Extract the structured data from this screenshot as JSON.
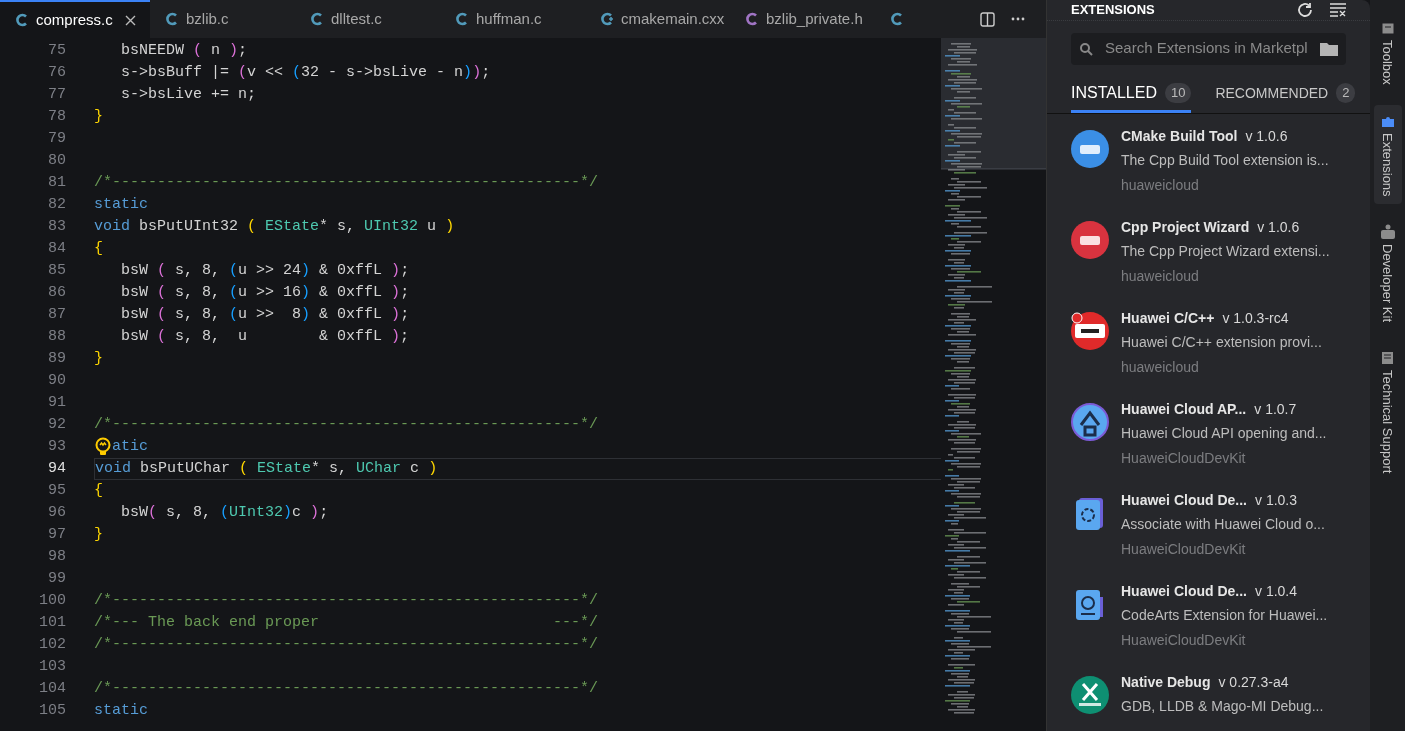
{
  "tabs": [
    {
      "label": "compress.c",
      "kind": "c",
      "selected": true
    },
    {
      "label": "bzlib.c",
      "kind": "c",
      "selected": false
    },
    {
      "label": "dlltest.c",
      "kind": "c",
      "selected": false
    },
    {
      "label": "huffman.c",
      "kind": "c",
      "selected": false
    },
    {
      "label": "cmakemain.cxx",
      "kind": "cpp",
      "selected": false
    },
    {
      "label": "bzlib_private.h",
      "kind": "h",
      "selected": false
    },
    {
      "kind": "c",
      "selected": false
    }
  ],
  "editor": {
    "lines": [
      {
        "number": "75",
        "tokens": [
          {
            "t": "   bsNEEDW ",
            "kind": "plain"
          },
          {
            "t": "(",
            "kind": "b2"
          },
          {
            "t": " n ",
            "kind": "plain"
          },
          {
            "t": ")",
            "kind": "b2"
          },
          {
            "t": ";",
            "kind": "plain"
          }
        ]
      },
      {
        "number": "76",
        "tokens": [
          {
            "t": "   s->bsBuff |= ",
            "kind": "plain"
          },
          {
            "t": "(",
            "kind": "b2"
          },
          {
            "t": "v << ",
            "kind": "plain"
          },
          {
            "t": "(",
            "kind": "b3"
          },
          {
            "t": "32 - s->bsLive - n",
            "kind": "plain"
          },
          {
            "t": ")",
            "kind": "b3"
          },
          {
            "t": ")",
            "kind": "b2"
          },
          {
            "t": ";",
            "kind": "plain"
          }
        ]
      },
      {
        "number": "77",
        "tokens": [
          {
            "t": "   s->bsLive += n;",
            "kind": "plain"
          }
        ]
      },
      {
        "number": "78",
        "tokens": [
          {
            "t": "}",
            "kind": "b1"
          }
        ]
      },
      {
        "number": "79"
      },
      {
        "number": "80"
      },
      {
        "number": "81",
        "tokens": [
          {
            "t": "/*----------------------------------------------------*/",
            "kind": "comment"
          }
        ]
      },
      {
        "number": "82",
        "tokens": [
          {
            "t": "static",
            "kind": "keyword"
          }
        ]
      },
      {
        "number": "83",
        "tokens": [
          {
            "t": "void",
            "kind": "keyword"
          },
          {
            "t": " bsPutUInt32 ",
            "kind": "plain"
          },
          {
            "t": "( ",
            "kind": "b1"
          },
          {
            "t": "EState",
            "kind": "type"
          },
          {
            "t": "* s, ",
            "kind": "plain"
          },
          {
            "t": "UInt32",
            "kind": "type"
          },
          {
            "t": " u ",
            "kind": "plain"
          },
          {
            "t": ")",
            "kind": "b1"
          }
        ]
      },
      {
        "number": "84",
        "tokens": [
          {
            "t": "{",
            "kind": "b1"
          }
        ]
      },
      {
        "number": "85",
        "tokens": [
          {
            "t": "   bsW ",
            "kind": "plain"
          },
          {
            "t": "(",
            "kind": "b2"
          },
          {
            "t": " s, 8, ",
            "kind": "plain"
          },
          {
            "t": "(",
            "kind": "b3"
          },
          {
            "t": "u >> 24",
            "kind": "plain"
          },
          {
            "t": ")",
            "kind": "b3"
          },
          {
            "t": " & 0xffL ",
            "kind": "plain"
          },
          {
            "t": ")",
            "kind": "b2"
          },
          {
            "t": ";",
            "kind": "plain"
          }
        ]
      },
      {
        "number": "86",
        "tokens": [
          {
            "t": "   bsW ",
            "kind": "plain"
          },
          {
            "t": "(",
            "kind": "b2"
          },
          {
            "t": " s, 8, ",
            "kind": "plain"
          },
          {
            "t": "(",
            "kind": "b3"
          },
          {
            "t": "u >> 16",
            "kind": "plain"
          },
          {
            "t": ")",
            "kind": "b3"
          },
          {
            "t": " & 0xffL ",
            "kind": "plain"
          },
          {
            "t": ")",
            "kind": "b2"
          },
          {
            "t": ";",
            "kind": "plain"
          }
        ]
      },
      {
        "number": "87",
        "tokens": [
          {
            "t": "   bsW ",
            "kind": "plain"
          },
          {
            "t": "(",
            "kind": "b2"
          },
          {
            "t": " s, 8, ",
            "kind": "plain"
          },
          {
            "t": "(",
            "kind": "b3"
          },
          {
            "t": "u >>  8",
            "kind": "plain"
          },
          {
            "t": ")",
            "kind": "b3"
          },
          {
            "t": " & 0xffL ",
            "kind": "plain"
          },
          {
            "t": ")",
            "kind": "b2"
          },
          {
            "t": ";",
            "kind": "plain"
          }
        ]
      },
      {
        "number": "88",
        "tokens": [
          {
            "t": "   bsW ",
            "kind": "plain"
          },
          {
            "t": "(",
            "kind": "b2"
          },
          {
            "t": " s, 8,  u        & 0xffL ",
            "kind": "plain"
          },
          {
            "t": ")",
            "kind": "b2"
          },
          {
            "t": ";",
            "kind": "plain"
          }
        ]
      },
      {
        "number": "89",
        "tokens": [
          {
            "t": "}",
            "kind": "b1"
          }
        ]
      },
      {
        "number": "90"
      },
      {
        "number": "91"
      },
      {
        "number": "92",
        "tokens": [
          {
            "t": "/*----------------------------------------------------*/",
            "kind": "comment"
          }
        ]
      },
      {
        "number": "93",
        "lightbulb": true,
        "tokens": [
          {
            "t": "atic",
            "kind": "keyword"
          }
        ]
      },
      {
        "number": "94",
        "current": true,
        "tokens": [
          {
            "t": "void",
            "kind": "keyword"
          },
          {
            "t": " bsPutUChar ",
            "kind": "plain"
          },
          {
            "t": "( ",
            "kind": "b1"
          },
          {
            "t": "EState",
            "kind": "type"
          },
          {
            "t": "* s, ",
            "kind": "plain"
          },
          {
            "t": "UChar",
            "kind": "type"
          },
          {
            "t": " c ",
            "kind": "plain"
          },
          {
            "t": ")",
            "kind": "b1"
          }
        ]
      },
      {
        "number": "95",
        "tokens": [
          {
            "t": "{",
            "kind": "b1"
          }
        ]
      },
      {
        "number": "96",
        "tokens": [
          {
            "t": "   bsW",
            "kind": "plain"
          },
          {
            "t": "(",
            "kind": "b2"
          },
          {
            "t": " s, 8, ",
            "kind": "plain"
          },
          {
            "t": "(",
            "kind": "b3"
          },
          {
            "t": "UInt32",
            "kind": "type"
          },
          {
            "t": ")",
            "kind": "b3"
          },
          {
            "t": "c ",
            "kind": "plain"
          },
          {
            "t": ")",
            "kind": "b2"
          },
          {
            "t": ";",
            "kind": "plain"
          }
        ]
      },
      {
        "number": "97",
        "tokens": [
          {
            "t": "}",
            "kind": "b1"
          }
        ]
      },
      {
        "number": "98"
      },
      {
        "number": "99"
      },
      {
        "number": "100",
        "tokens": [
          {
            "t": "/*----------------------------------------------------*/",
            "kind": "comment"
          }
        ]
      },
      {
        "number": "101",
        "tokens": [
          {
            "t": "/*--- The back end proper                          ---*/",
            "kind": "comment"
          }
        ]
      },
      {
        "number": "102",
        "tokens": [
          {
            "t": "/*----------------------------------------------------*/",
            "kind": "comment"
          }
        ]
      },
      {
        "number": "103"
      },
      {
        "number": "104",
        "tokens": [
          {
            "t": "/*----------------------------------------------------*/",
            "kind": "comment"
          }
        ]
      },
      {
        "number": "105",
        "tokens": [
          {
            "t": "static",
            "kind": "keyword"
          }
        ]
      }
    ]
  },
  "extensions": {
    "title": "EXTENSIONS",
    "search": {
      "placeholder": "Search Extensions in Marketpl"
    },
    "tabs": [
      {
        "label": "INSTALLED",
        "count": "10",
        "selected": true
      },
      {
        "label": "RECOMMENDED",
        "count": "2",
        "selected": false
      }
    ],
    "items": [
      {
        "kind": "cmake",
        "name": "CMake Build Tool",
        "version": "v 1.0.6",
        "description": "The Cpp Build Tool extension is...",
        "publisher": "huaweicloud"
      },
      {
        "kind": "wizard",
        "name": "Cpp Project Wizard",
        "version": "v 1.0.6",
        "description": "The Cpp Project Wizard extensi...",
        "publisher": "huaweicloud"
      },
      {
        "kind": "huawei",
        "name": "Huawei C/C++",
        "version": "v 1.0.3-rc4",
        "description": "Huawei C/C++ extension provi...",
        "publisher": "huaweicloud"
      },
      {
        "kind": "api",
        "name": "Huawei Cloud AP...",
        "version": "v 1.0.7",
        "description": "Huawei Cloud API opening and...",
        "publisher": "HuaweiCloudDevKit"
      },
      {
        "kind": "link",
        "name": "Huawei Cloud De...",
        "version": "v 1.0.3",
        "description": "Associate with Huawei Cloud o...",
        "publisher": "HuaweiCloudDevKit"
      },
      {
        "kind": "help",
        "name": "Huawei Cloud De...",
        "version": "v 1.0.4",
        "description": "CodeArts Extension for Huawei...",
        "publisher": "HuaweiCloudDevKit"
      },
      {
        "kind": "native",
        "name": "Native Debug",
        "version": "v 0.27.3-a4",
        "description": "GDB, LLDB & Mago-MI Debug..."
      }
    ]
  },
  "activity_bar": [
    {
      "label": "Toolbox",
      "kind": "toolbox",
      "selected": false
    },
    {
      "label": "Extensions",
      "kind": "puzzle",
      "selected": true
    },
    {
      "label": "Developer Kit",
      "kind": "kit",
      "selected": false
    },
    {
      "label": "Technical Support",
      "kind": "support",
      "selected": false
    }
  ]
}
